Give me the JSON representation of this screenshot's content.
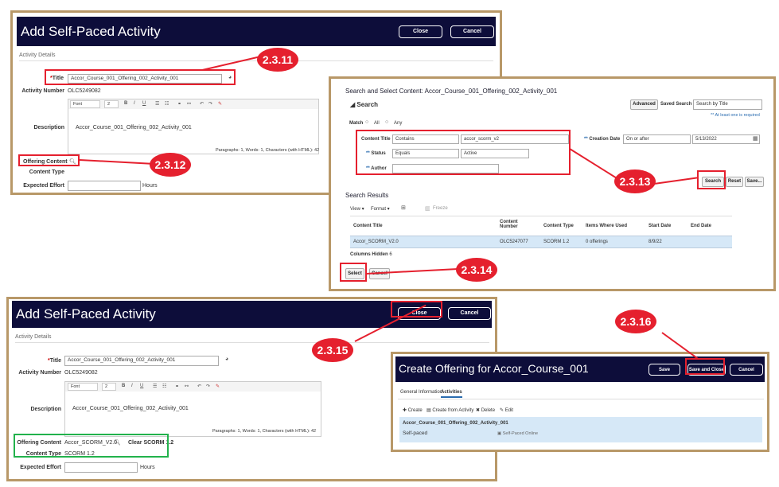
{
  "panel1": {
    "title": "Add Self-Paced Activity",
    "close": "Close",
    "cancel": "Cancel",
    "section": "Activity Details",
    "title_label": "Title",
    "title_value": "Accor_Course_001_Offering_002_Activity_001",
    "activity_number_label": "Activity Number",
    "activity_number": "OLC5249082",
    "description_label": "Description",
    "font": "Font",
    "size": "2",
    "description_text": "Accor_Course_001_Offering_002_Activity_001",
    "editor_status": "Paragraphs: 1, Words: 1, Characters (with HTML): 42",
    "offering_content_label": "Offering Content",
    "content_type_label": "Content Type",
    "expected_effort_label": "Expected Effort",
    "hours": "Hours"
  },
  "panel2": {
    "title": "Search and Select Content: Accor_Course_001_Offering_002_Activity_001",
    "search_header": "Search",
    "advanced": "Advanced",
    "saved_search_label": "Saved Search",
    "saved_search_value": "Search by Title",
    "required_note": "** At least one is required",
    "match_label": "Match",
    "match_all": "All",
    "match_any": "Any",
    "content_title_label": "Content Title",
    "content_title_op": "Contains",
    "content_title_value": "accor_scorm_v2",
    "status_label": "Status",
    "status_op": "Equals",
    "status_value": "Active",
    "author_label": "Author",
    "creation_date_label": "Creation Date",
    "creation_date_op": "On or after",
    "creation_date_value": "5/13/2022",
    "search_btn": "Search",
    "reset_btn": "Reset",
    "save_btn": "Save...",
    "results_header": "Search Results",
    "view": "View",
    "format": "Format",
    "freeze": "Freeze",
    "columns": [
      "Content Title",
      "Content Number",
      "Content Type",
      "Items Where Used",
      "Start Date",
      "End Date"
    ],
    "row": [
      "Accor_SCORM_V2.0",
      "OLC5247077",
      "SCORM 1.2",
      "0 offerings",
      "8/9/22",
      ""
    ],
    "columns_hidden": "Columns Hidden",
    "columns_hidden_count": "6",
    "select_btn": "Select",
    "cancel_btn": "Cancel"
  },
  "panel3": {
    "title": "Add Self-Paced Activity",
    "close": "Close",
    "cancel": "Cancel",
    "section": "Activity Details",
    "title_label": "Title",
    "title_value": "Accor_Course_001_Offering_002_Activity_001",
    "activity_number_label": "Activity Number",
    "activity_number": "OLC5249082",
    "description_label": "Description",
    "font": "Font",
    "size": "2",
    "description_text": "Accor_Course_001_Offering_002_Activity_001",
    "editor_status": "Paragraphs: 1, Words: 1, Characters (with HTML): 42",
    "offering_content_label": "Offering Content",
    "offering_content_value": "Accor_SCORM_V2.0",
    "clear_link": "Clear SCORM 1.2",
    "content_type_label": "Content Type",
    "content_type_value": "SCORM 1.2",
    "expected_effort_label": "Expected Effort",
    "hours": "Hours"
  },
  "panel4": {
    "title": "Create Offering for Accor_Course_001",
    "save": "Save",
    "save_close": "Save and Close",
    "cancel": "Cancel",
    "tab_general": "General Information",
    "tab_activities": "Activities",
    "create": "Create",
    "create_from": "Create from Activity",
    "delete": "Delete",
    "edit": "Edit",
    "activity_name": "Accor_Course_001_Offering_002_Activity_001",
    "activity_type": "Self-paced",
    "activity_mode": "Self-Paced Online"
  },
  "callouts": {
    "c2311": "2.3.11",
    "c2312": "2.3.12",
    "c2313": "2.3.13",
    "c2314": "2.3.14",
    "c2315": "2.3.15",
    "c2316": "2.3.16"
  },
  "colors": {
    "header_bg": "#0d0d3a",
    "border": "#b89868",
    "callout_red": "#e5202e",
    "highlight_green": "#22b24c",
    "selected_row": "#d6e8f7"
  }
}
